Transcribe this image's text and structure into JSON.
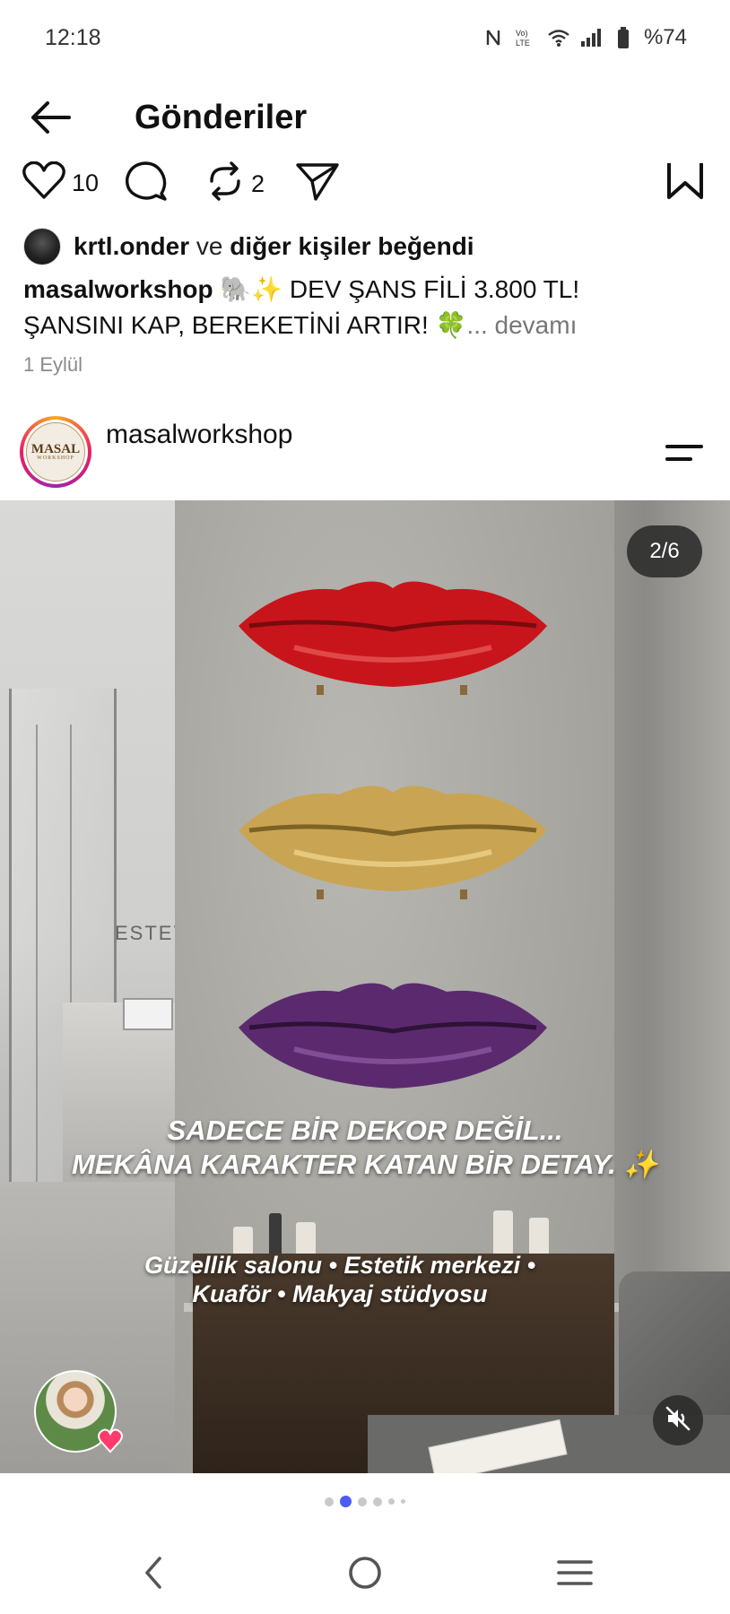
{
  "status_bar": {
    "time": "12:18",
    "battery": "%74",
    "icons": [
      "nfc-icon",
      "volte-icon",
      "wifi-icon",
      "signal-icon",
      "battery-icon"
    ]
  },
  "header": {
    "title": "Gönderiler",
    "back_icon": "arrow-left-icon"
  },
  "actions": {
    "like_count": "10",
    "repost_count": "2",
    "icons": [
      "heart-icon",
      "comment-icon",
      "repost-icon",
      "share-icon",
      "save-icon"
    ]
  },
  "likes": {
    "user": "krtl.onder",
    "connector": "ve",
    "others": "diğer kişiler beğendi"
  },
  "caption": {
    "user": "masalworkshop",
    "text": "🐘✨ DEV ŞANS FİLİ 3.800 TL! ŞANSINI KAP, BEREKETİNİ ARTIR! 🍀",
    "more": "... devamı"
  },
  "date": "1 Eylül",
  "post": {
    "username": "masalworkshop",
    "avatar_logo": "MASAL",
    "avatar_sub": "WORKSHOP",
    "counter": "2/6",
    "wall_sign": "ESTET",
    "overlay_line1": "SADECE BİR DEKOR DEĞİL...",
    "overlay_line2": "MEKÂNA KARAKTER KATAN BİR DETAY. ✨",
    "overlay_line3": "Güzellik salonu • Estetik merkezi •",
    "overlay_line4": "Kuaför • Makyaj stüdyosu",
    "lip_colors": [
      "#c8151b",
      "#c9a553",
      "#5b2a6e"
    ],
    "mute_icon": "mute-icon"
  },
  "carousel": {
    "total": 6,
    "active_index": 1
  },
  "nav": {
    "icons": [
      "nav-back-icon",
      "nav-home-icon",
      "nav-recents-icon"
    ]
  },
  "colors": {
    "accent_dot": "#4b5cf0",
    "muted_text": "#8a8a8a"
  }
}
